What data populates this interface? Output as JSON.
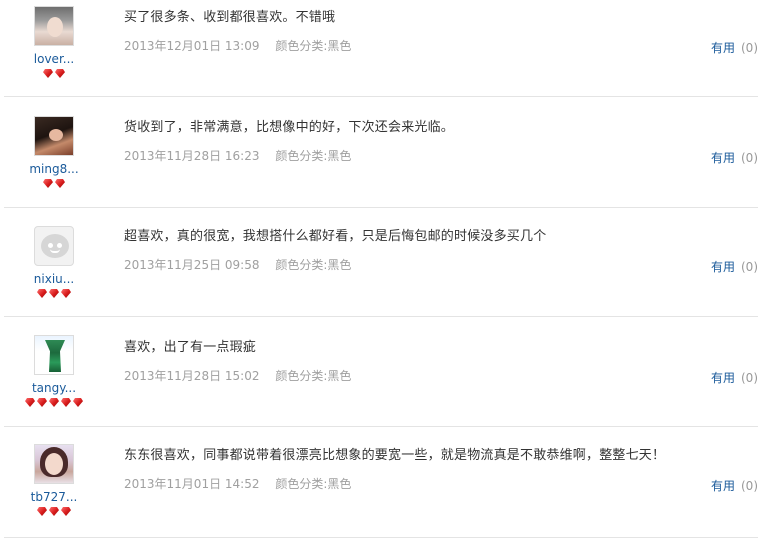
{
  "reviews": [
    {
      "username": "lover...",
      "avatar": "user-photo",
      "gems": 2,
      "comment": "买了很多条、收到都很喜欢。不错哦",
      "date": "2013年12月01日 13:09",
      "color_label": "颜色分类:黑色",
      "helpful_label": "有用",
      "helpful_count": "(0)"
    },
    {
      "username": "ming8...",
      "avatar": "user-photo",
      "gems": 2,
      "comment": "货收到了，非常满意，比想像中的好，下次还会来光临。",
      "date": "2013年11月28日 16:23",
      "color_label": "颜色分类:黑色",
      "helpful_label": "有用",
      "helpful_count": "(0)"
    },
    {
      "username": "nixiu...",
      "avatar": "default-avatar",
      "gems": 3,
      "comment": "超喜欢，真的很宽，我想搭什么都好看，只是后悔包邮的时候没多买几个",
      "date": "2013年11月25日 09:58",
      "color_label": "颜色分类:黑色",
      "helpful_label": "有用",
      "helpful_count": "(0)"
    },
    {
      "username": "tangy...",
      "avatar": "vase-photo",
      "gems": 5,
      "comment": "喜欢，出了有一点瑕疵",
      "date": "2013年11月28日 15:02",
      "color_label": "颜色分类:黑色",
      "helpful_label": "有用",
      "helpful_count": "(0)"
    },
    {
      "username": "tb727...",
      "avatar": "user-photo",
      "gems": 3,
      "comment": "东东很喜欢，同事都说带着很漂亮比想象的要宽一些，就是物流真是不敢恭维啊，整整七天！",
      "date": "2013年11月01日 14:52",
      "color_label": "颜色分类:黑色",
      "helpful_label": "有用",
      "helpful_count": "(0)"
    }
  ],
  "colors": {
    "link": "#1a5a9a",
    "meta": "#a0a0a0",
    "gem": "#d81b1b",
    "divider": "#e4e4e4"
  }
}
